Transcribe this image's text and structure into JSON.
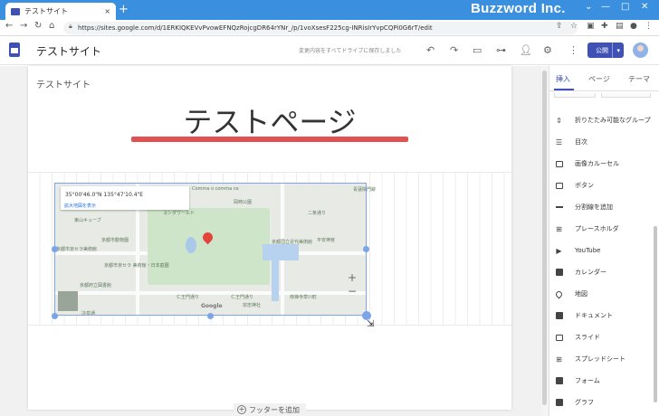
{
  "browser": {
    "tab_title": "テストサイト",
    "tab_close": "×",
    "new_tab": "+",
    "brand_overlay": "Buzzword Inc.",
    "window_controls": [
      "⌄",
      "—",
      "□",
      "✕"
    ],
    "url": "https://sites.google.com/d/1ERKIQKEVvPvowEFNQzRojcgDR64rYNr_/p/1voXsesF225cg-INRisIrYvpCQPi0G6rT/edit",
    "nav_icons": [
      "back-icon",
      "forward-icon",
      "reload-icon",
      "home-icon"
    ]
  },
  "app_header": {
    "site_name": "テストサイト",
    "save_status": "変更内容をすべてドライブに保存しました",
    "publish_label": "公開",
    "publish_dropdown": "▾",
    "icons": [
      "undo-icon",
      "redo-icon",
      "preview-icon",
      "link-icon",
      "share-icon",
      "settings-icon",
      "more-icon"
    ]
  },
  "page": {
    "header_label": "テストサイト",
    "title": "テストページ",
    "footer_add": "フッターを追加",
    "footer_plus": "+"
  },
  "map": {
    "coord_text": "35°00'46.0\"N 135°47'10.4\"E",
    "coord_link": "拡大地図を表示",
    "zoom_in": "+",
    "zoom_out": "−",
    "google_logo": "Google",
    "labels": {
      "comma": "Comma o comma ce",
      "kyoto_museum": "岡崎公園",
      "world": "ヨシダワールド",
      "nijo": "二条通り",
      "heian": "平安神宮",
      "kumamoto": "京都市動物園",
      "museum": "京都市京セラ美術館",
      "kyoto_art": "京都市京セラ 美術館・日本庭園",
      "ninoumon": "仁王門通り",
      "ninoumon2": "仁王門通り",
      "sanjo": "南禅寺草川町",
      "koyasan": "京都国立近代美術館",
      "soushou": "宗忠神社",
      "kumagai": "冷泉通",
      "kyokyu": "東山キューブ",
      "kyoto_pref": "京都府立図書館",
      "shoren": "青蓮院門跡"
    }
  },
  "panel": {
    "tabs": [
      "挿入",
      "ページ",
      "テーマ"
    ],
    "active_tab": "挿入",
    "items": [
      {
        "icon": "collapsible-icon",
        "label": "折りたたみ可能なグループ"
      },
      {
        "icon": "toc-icon",
        "label": "目次"
      },
      {
        "icon": "carousel-icon",
        "label": "画像カルーセル"
      },
      {
        "icon": "button-icon",
        "label": "ボタン"
      },
      {
        "icon": "divider-icon",
        "label": "分割線を追加"
      },
      {
        "icon": "placeholder-icon",
        "label": "プレースホルダ"
      },
      {
        "icon": "youtube-icon",
        "label": "YouTube"
      },
      {
        "icon": "calendar-icon",
        "label": "カレンダー"
      },
      {
        "icon": "map-icon",
        "label": "地図"
      },
      {
        "icon": "docs-icon",
        "label": "ドキュメント"
      },
      {
        "icon": "slides-icon",
        "label": "スライド"
      },
      {
        "icon": "sheets-icon",
        "label": "スプレッドシート"
      },
      {
        "icon": "forms-icon",
        "label": "フォーム"
      },
      {
        "icon": "charts-icon",
        "label": "グラフ"
      }
    ]
  },
  "colors": {
    "browser_titlebar": "#3b8fdf",
    "accent": "#3f51b5",
    "title_underline": "#e25050",
    "map_selection": "#7ba5e8"
  }
}
